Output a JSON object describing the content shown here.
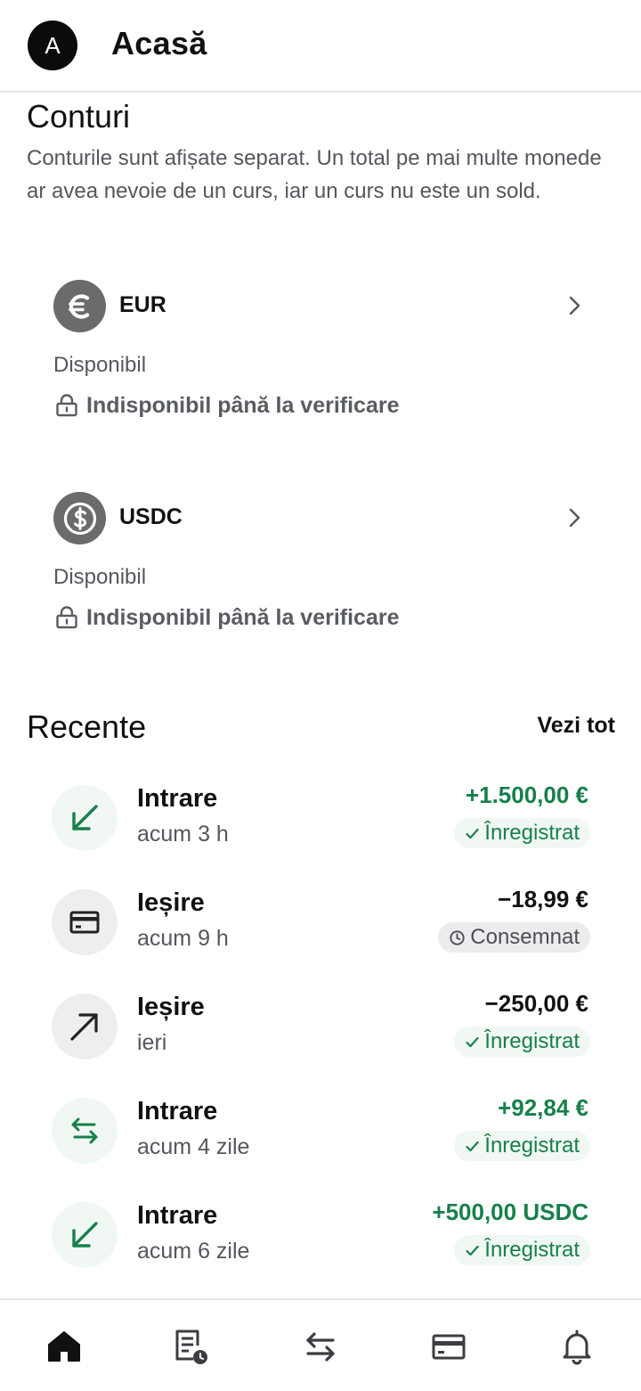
{
  "header": {
    "avatar_initial": "A",
    "title": "Acasă"
  },
  "accounts_section": {
    "title": "Conturi",
    "description": "Conturile sunt afișate separat. Un total pe mai multe monede ar avea nevoie de un curs, iar un curs nu este un sold.",
    "accounts": [
      {
        "code": "EUR",
        "icon": "euro-icon",
        "available_label": "Disponibil",
        "status": "Indisponibil până la verificare"
      },
      {
        "code": "USDC",
        "icon": "dollar-coin-icon",
        "available_label": "Disponibil",
        "status": "Indisponibil până la verificare"
      }
    ]
  },
  "recent_section": {
    "title": "Recente",
    "see_all": "Vezi tot",
    "transactions": [
      {
        "name": "Intrare",
        "time": "acum 3 h",
        "amount": "+1.500,00 €",
        "status": "Înregistrat",
        "icon": "arrow-down-left-icon"
      },
      {
        "name": "Ieșire",
        "time": "acum 9 h",
        "amount": "−18,99 €",
        "status": "Consemnat",
        "icon": "card-icon"
      },
      {
        "name": "Ieșire",
        "time": "ieri",
        "amount": "−250,00 €",
        "status": "Înregistrat",
        "icon": "arrow-up-right-icon"
      },
      {
        "name": "Intrare",
        "time": "acum 4 zile",
        "amount": "+92,84 €",
        "status": "Înregistrat",
        "icon": "exchange-icon"
      },
      {
        "name": "Intrare",
        "time": "acum 6 zile",
        "amount": "+500,00 USDC",
        "status": "Înregistrat",
        "icon": "arrow-down-left-icon"
      }
    ]
  },
  "bottom_nav": {
    "items": [
      {
        "icon": "home-icon",
        "active": true
      },
      {
        "icon": "statements-icon",
        "active": false
      },
      {
        "icon": "transfer-icon",
        "active": false
      },
      {
        "icon": "card-icon",
        "active": false
      },
      {
        "icon": "bell-icon",
        "active": false
      }
    ]
  },
  "colors": {
    "positive": "#17804b",
    "text": "#111111",
    "muted": "#55575e",
    "coin": "#6b6b6e"
  }
}
